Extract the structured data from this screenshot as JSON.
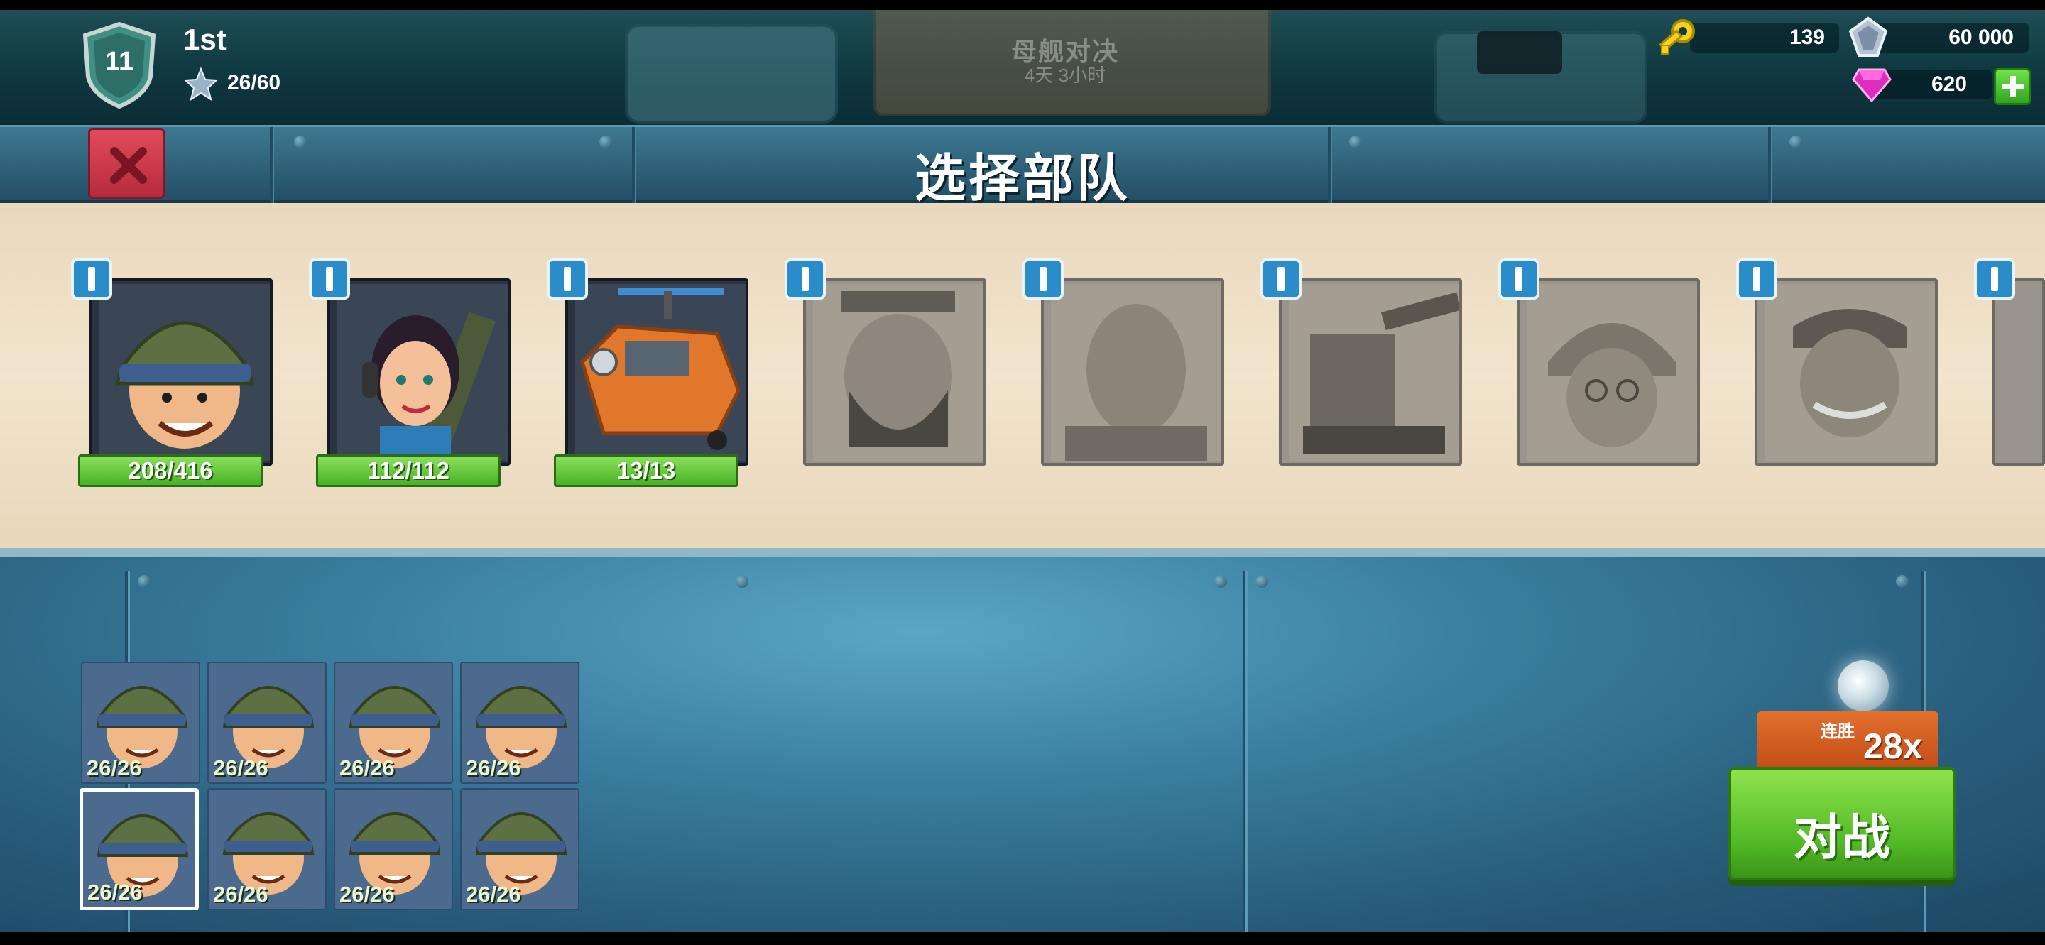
{
  "player": {
    "level": "11",
    "rank": "1st",
    "stars": "26/60"
  },
  "event": {
    "name": "母舰对决",
    "timer": "4天 3小时"
  },
  "resources": {
    "keys": "139",
    "diamonds": "60 000",
    "gems": "620"
  },
  "header": {
    "title": "选择部队"
  },
  "roster": {
    "units": [
      {
        "name": "rifleman",
        "count": "208/416",
        "locked": false
      },
      {
        "name": "zooka",
        "count": "112/112",
        "locked": false
      },
      {
        "name": "heavy-choppa",
        "count": "13/13",
        "locked": false
      },
      {
        "name": "heavy",
        "count": "",
        "locked": true
      },
      {
        "name": "warrior",
        "count": "",
        "locked": true
      },
      {
        "name": "tank",
        "count": "",
        "locked": true
      },
      {
        "name": "medic",
        "count": "",
        "locked": true
      },
      {
        "name": "grenadier",
        "count": "",
        "locked": true
      },
      {
        "name": "partial",
        "count": "",
        "locked": true
      }
    ]
  },
  "army": {
    "slots": [
      {
        "count": "26/26"
      },
      {
        "count": "26/26"
      },
      {
        "count": "26/26"
      },
      {
        "count": "26/26"
      },
      {
        "count": "26/26",
        "selected": true
      },
      {
        "count": "26/26"
      },
      {
        "count": "26/26"
      },
      {
        "count": "26/26"
      }
    ]
  },
  "streak": {
    "label": "连胜",
    "value": "28x"
  },
  "battle": {
    "label": "对战"
  },
  "colors": {
    "accent_green": "#4fb825",
    "close_red": "#c93346",
    "info_blue": "#2a8cc8",
    "streak_orange": "#d85d20"
  }
}
